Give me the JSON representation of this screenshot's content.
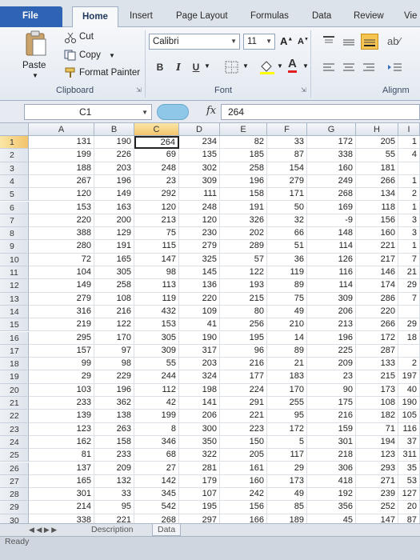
{
  "ribbon_tabs": [
    "File",
    "Home",
    "Insert",
    "Page Layout",
    "Formulas",
    "Data",
    "Review",
    "Vie"
  ],
  "active_tab": "Home",
  "clipboard": {
    "paste_label": "Paste",
    "cut_label": "Cut",
    "copy_label": "Copy",
    "format_painter_label": "Format Painter",
    "group_label": "Clipboard"
  },
  "font": {
    "font_name": "Calibri",
    "font_size": "11",
    "bold": "B",
    "italic": "I",
    "underline": "U",
    "group_label": "Font"
  },
  "alignment": {
    "group_label": "Alignm"
  },
  "formula_bar": {
    "name_box": "C1",
    "fx": "fx",
    "value": "264"
  },
  "columns": [
    "A",
    "B",
    "C",
    "D",
    "E",
    "F",
    "G",
    "H",
    "I"
  ],
  "selected_column": "C",
  "selected_row": 1,
  "rows": [
    [
      "1",
      "131",
      "190",
      "264",
      "234",
      "82",
      "33",
      "172",
      "205",
      "1"
    ],
    [
      "2",
      "199",
      "226",
      "69",
      "135",
      "185",
      "87",
      "338",
      "55",
      "4"
    ],
    [
      "3",
      "188",
      "203",
      "248",
      "302",
      "258",
      "154",
      "160",
      "181",
      ""
    ],
    [
      "4",
      "267",
      "196",
      "23",
      "309",
      "196",
      "279",
      "249",
      "266",
      "1"
    ],
    [
      "5",
      "120",
      "149",
      "292",
      "111",
      "158",
      "171",
      "268",
      "134",
      "2"
    ],
    [
      "6",
      "153",
      "163",
      "120",
      "248",
      "191",
      "50",
      "169",
      "118",
      "1"
    ],
    [
      "7",
      "220",
      "200",
      "213",
      "120",
      "326",
      "32",
      "-9",
      "156",
      "3"
    ],
    [
      "8",
      "388",
      "129",
      "75",
      "230",
      "202",
      "66",
      "148",
      "160",
      "3"
    ],
    [
      "9",
      "280",
      "191",
      "115",
      "279",
      "289",
      "51",
      "114",
      "221",
      "1"
    ],
    [
      "10",
      "72",
      "165",
      "147",
      "325",
      "57",
      "36",
      "126",
      "217",
      "7"
    ],
    [
      "11",
      "104",
      "305",
      "98",
      "145",
      "122",
      "119",
      "116",
      "146",
      "21"
    ],
    [
      "12",
      "149",
      "258",
      "113",
      "136",
      "193",
      "89",
      "114",
      "174",
      "29"
    ],
    [
      "13",
      "279",
      "108",
      "119",
      "220",
      "215",
      "75",
      "309",
      "286",
      "7"
    ],
    [
      "14",
      "316",
      "216",
      "432",
      "109",
      "80",
      "49",
      "206",
      "220",
      ""
    ],
    [
      "15",
      "219",
      "122",
      "153",
      "41",
      "256",
      "210",
      "213",
      "266",
      "29"
    ],
    [
      "16",
      "295",
      "170",
      "305",
      "190",
      "195",
      "14",
      "196",
      "172",
      "18"
    ],
    [
      "17",
      "157",
      "97",
      "309",
      "317",
      "96",
      "89",
      "225",
      "287",
      ""
    ],
    [
      "18",
      "99",
      "98",
      "55",
      "203",
      "216",
      "21",
      "209",
      "133",
      "2"
    ],
    [
      "19",
      "29",
      "229",
      "244",
      "324",
      "177",
      "183",
      "23",
      "215",
      "197"
    ],
    [
      "20",
      "103",
      "196",
      "112",
      "198",
      "224",
      "170",
      "90",
      "173",
      "40"
    ],
    [
      "21",
      "233",
      "362",
      "42",
      "141",
      "291",
      "255",
      "175",
      "108",
      "190"
    ],
    [
      "22",
      "139",
      "138",
      "199",
      "206",
      "221",
      "95",
      "216",
      "182",
      "105"
    ],
    [
      "23",
      "123",
      "263",
      "8",
      "300",
      "223",
      "172",
      "159",
      "71",
      "116"
    ],
    [
      "24",
      "162",
      "158",
      "346",
      "350",
      "150",
      "5",
      "301",
      "194",
      "37"
    ],
    [
      "25",
      "81",
      "233",
      "68",
      "322",
      "205",
      "117",
      "218",
      "123",
      "311"
    ],
    [
      "26",
      "137",
      "209",
      "27",
      "281",
      "161",
      "29",
      "306",
      "293",
      "35"
    ],
    [
      "27",
      "165",
      "132",
      "142",
      "179",
      "160",
      "173",
      "418",
      "271",
      "53"
    ],
    [
      "28",
      "301",
      "33",
      "345",
      "107",
      "242",
      "49",
      "192",
      "239",
      "127"
    ],
    [
      "29",
      "214",
      "95",
      "542",
      "195",
      "156",
      "85",
      "356",
      "252",
      "20"
    ],
    [
      "30",
      "338",
      "221",
      "268",
      "297",
      "166",
      "189",
      "45",
      "147",
      "87"
    ]
  ],
  "sheet_tabs": [
    "Description",
    "Data"
  ],
  "status_text": "Ready"
}
